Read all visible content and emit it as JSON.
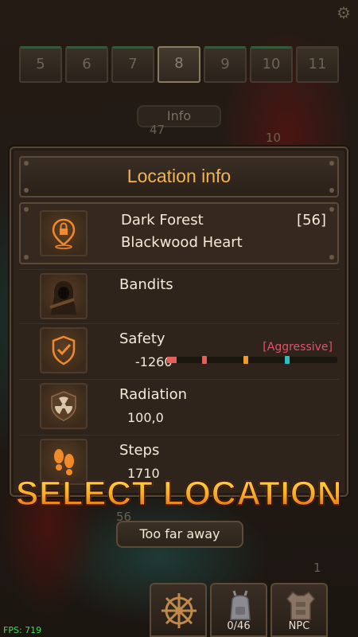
{
  "level_tabs": [
    {
      "label": "5",
      "state": "done"
    },
    {
      "label": "6",
      "state": "done"
    },
    {
      "label": "7",
      "state": "done"
    },
    {
      "label": "8",
      "state": "active"
    },
    {
      "label": "9",
      "state": "done"
    },
    {
      "label": "10",
      "state": "done"
    },
    {
      "label": "11",
      "state": "locked"
    }
  ],
  "map": {
    "info_button": "Info",
    "numbers": [
      "47",
      "10",
      "56",
      "1"
    ]
  },
  "panel": {
    "title": "Location info",
    "location": {
      "name": "Dark Forest",
      "level": "[56]",
      "subname": "Blackwood Heart",
      "icon": "location-pin-lock-icon"
    },
    "faction": {
      "label": "Bandits",
      "icon": "bandit-portrait-icon"
    },
    "safety": {
      "label": "Safety",
      "value": "-1260",
      "status": "[Aggressive]",
      "icon": "shield-check-icon",
      "status_color": "#e8506a"
    },
    "radiation": {
      "label": "Radiation",
      "value": "100,0",
      "icon": "radiation-icon"
    },
    "steps": {
      "label": "Steps",
      "value": "1710",
      "icon": "footprints-icon"
    }
  },
  "overlay": {
    "select_location": "SELECT LOCATION"
  },
  "too_far_button": "Too far away",
  "bottom_nav": {
    "compass": {
      "label": "",
      "icon": "compass-wheel-icon"
    },
    "inventory": {
      "label": "0/46",
      "icon": "backpack-icon"
    },
    "npc": {
      "label": "NPC",
      "icon": "armor-vest-icon"
    }
  },
  "fps": "FPS: 719",
  "colors": {
    "accent": "#f4b350",
    "status_aggressive": "#e8506a",
    "fps": "#3fdc5a"
  }
}
